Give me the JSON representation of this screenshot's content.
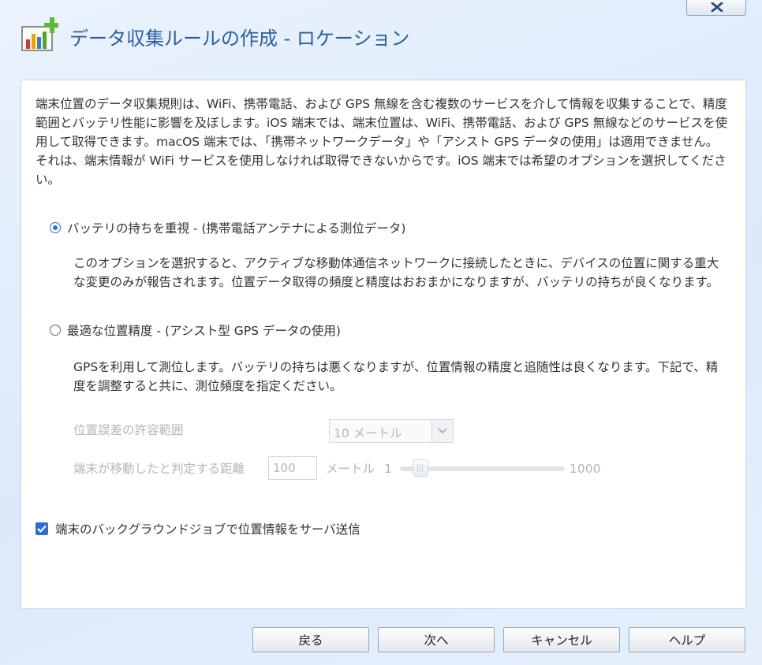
{
  "window": {
    "title": "データ収集ルールの作成 - ロケーション",
    "close_icon": "close-icon"
  },
  "intro": {
    "text": "端末位置のデータ収集規則は、WiFi、携帯電話、および GPS 無線を含む複数のサービスを介して情報を収集することで、精度範囲とバッテリ性能に影響を及ぼします。iOS 端末では、端末位置は、WiFi、携帯電話、および GPS 無線などのサービスを使用して取得できます。macOS 端末では、「携帯ネットワークデータ」や「アシスト GPS データの使用」は適用できません。それは、端末情報が WiFi サービスを使用しなければ取得できないからです。iOS 端末では希望のオプションを選択してください。"
  },
  "options": {
    "battery": {
      "label": "バッテリの持ちを重視 - (携帯電話アンテナによる測位データ)",
      "description": "このオプションを選択すると、アクティブな移動体通信ネットワークに接続したときに、デバイスの位置に関する重大な変更のみが報告されます。位置データ取得の頻度と精度はおおまかになりますが、バッテリの持ちが良くなります。",
      "selected": true
    },
    "accuracy": {
      "label": "最適な位置精度 - (アシスト型 GPS データの使用)",
      "description": "GPSを利用して測位します。バッテリの持ちは悪くなりますが、位置情報の精度と追随性は良くなります。下記で、精度を調整すると共に、測位頻度を指定ください。",
      "selected": false
    }
  },
  "accuracy_settings": {
    "tolerance_label": "位置誤差の許容範囲",
    "tolerance_value": "10 メートル",
    "distance_label": "端末が移動したと判定する距離",
    "distance_value": "100",
    "distance_unit": "メートル",
    "slider_min": "1",
    "slider_max": "1000",
    "slider_value": 100
  },
  "background": {
    "label": "端末のバックグラウンドジョブで位置情報をサーバ送信",
    "checked": true
  },
  "buttons": {
    "back": "戻る",
    "next": "次へ",
    "cancel": "キャンセル",
    "help": "ヘルプ"
  },
  "colors": {
    "title": "#2a5da8",
    "accent": "#2b6fd6",
    "disabled_text": "#b6b6b6"
  }
}
